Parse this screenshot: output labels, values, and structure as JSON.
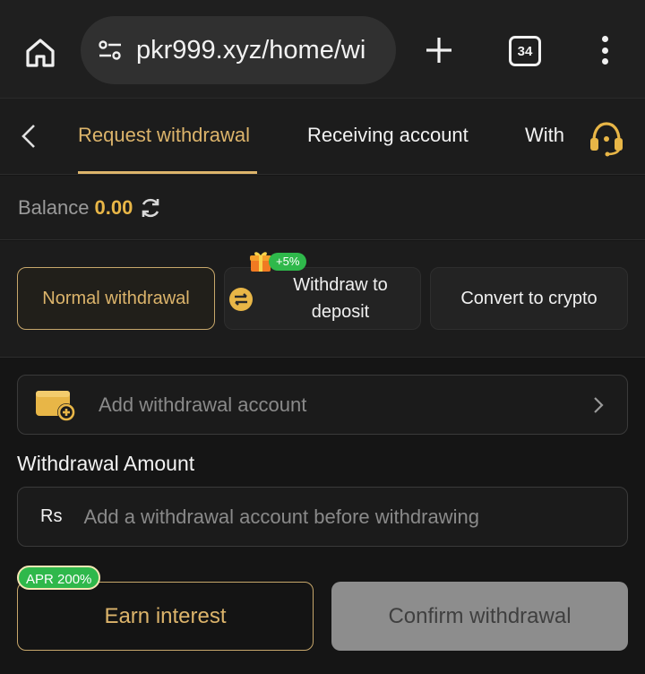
{
  "browser": {
    "url": "pkr999.xyz/home/wi",
    "tab_count": "34",
    "icons": {
      "home": "home-icon",
      "site_settings": "tune-icon",
      "new_tab": "plus-icon",
      "tabs": "tabs-icon",
      "menu": "more-vert-icon"
    }
  },
  "nav": {
    "tabs": [
      {
        "label": "Request withdrawal",
        "active": true
      },
      {
        "label": "Receiving account",
        "active": false
      },
      {
        "label": "With",
        "active": false
      }
    ]
  },
  "balance": {
    "label": "Balance",
    "value": "0.00"
  },
  "methods": {
    "normal": "Normal withdrawal",
    "deposit_line1": "Withdraw to",
    "deposit_line2": "deposit",
    "deposit_badge": "+5%",
    "crypto": "Convert to crypto"
  },
  "form": {
    "account_placeholder": "Add withdrawal account",
    "amount_label": "Withdrawal Amount",
    "currency": "Rs",
    "amount_placeholder": "Add a withdrawal account before withdrawing"
  },
  "actions": {
    "earn_label": "Earn interest",
    "apr_badge": "APR 200%",
    "confirm_label": "Confirm withdrawal"
  },
  "colors": {
    "accent_gold": "#dcb46b",
    "balance_gold": "#e8b647",
    "badge_green": "#2fb84b",
    "background": "#151515",
    "disabled_button": "#8d8d8d"
  }
}
